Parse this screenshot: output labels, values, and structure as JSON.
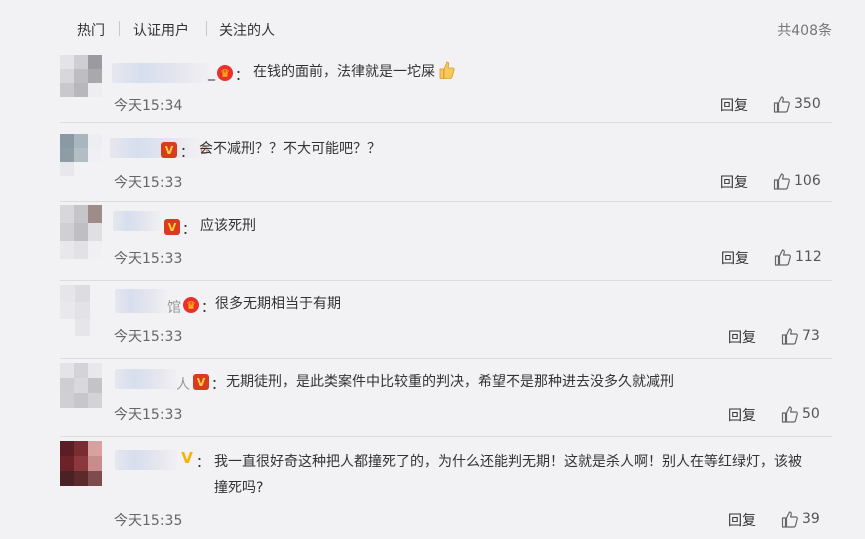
{
  "tabs": [
    {
      "label": "热门"
    },
    {
      "label": "认证用户"
    },
    {
      "label": "关注的人"
    }
  ],
  "total_count": "共408条",
  "reply_label": "回复",
  "colors": {
    "background": "#f2f2f5",
    "divider": "#dcdcdc",
    "badge_red": "#d83b1f",
    "badge_gold": "#f6b400"
  },
  "comments": [
    {
      "name_visible": "_",
      "badge": "crown-icon",
      "text": "在钱的面前，法律就是一坨屎",
      "time": "今天15:34",
      "likes": "350"
    },
    {
      "name_visible": "o",
      "badge": "vip-v-icon",
      "text": "会不减刑？？不大可能吧？？",
      "time": "今天15:33",
      "likes": "106"
    },
    {
      "name_visible": "",
      "badge": "vip-v-icon",
      "text": "应该死刑",
      "time": "今天15:33",
      "likes": "112"
    },
    {
      "name_visible": "馆",
      "badge": "crown-icon",
      "text": "很多无期相当于有期",
      "time": "今天15:33",
      "likes": "73"
    },
    {
      "name_visible": "人",
      "badge": "vip-v-icon",
      "text": "无期徒刑，是此类案件中比较重的判决，希望不是那种进去没多久就减刑",
      "time": "今天15:33",
      "likes": "50"
    },
    {
      "name_visible": "",
      "badge": "verified-v-icon",
      "text": "我一直很好奇这种把人都撞死了的，为什么还能判无期！这就是杀人啊！别人在等红绿灯，该被撞死吗?",
      "time": "今天15:35",
      "likes": "39"
    }
  ]
}
